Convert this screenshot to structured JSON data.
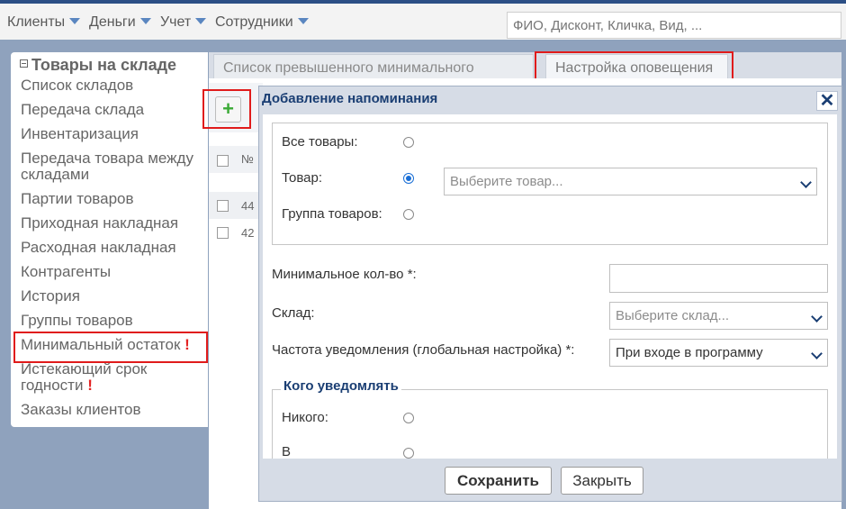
{
  "topbar": {
    "menus": [
      "Клиенты",
      "Деньги",
      "Учет",
      "Сотрудники"
    ],
    "search_placeholder": "ФИО, Дисконт, Кличка, Вид, ..."
  },
  "sidebar": {
    "title": "Товары на складе",
    "items": [
      {
        "label": "Список складов"
      },
      {
        "label": "Передача склада"
      },
      {
        "label": "Инвентаризация"
      },
      {
        "label": "Передача товара между складами"
      },
      {
        "label": "Партии товаров"
      },
      {
        "label": "Приходная накладная"
      },
      {
        "label": "Расходная накладная"
      },
      {
        "label": "Контрагенты"
      },
      {
        "label": "История"
      },
      {
        "label": "Группы товаров"
      },
      {
        "label": "Минимальный остаток",
        "badge": "!"
      },
      {
        "label": "Истекающий срок годности",
        "badge": "!"
      },
      {
        "label": "Заказы клиентов"
      }
    ]
  },
  "tabs": [
    {
      "label": "Список превышенного минимального остатка"
    },
    {
      "label": "Настройка оповещения"
    }
  ],
  "toolbar": {
    "add_label": "+"
  },
  "grid": {
    "header_num": "№",
    "rows": [
      {
        "num": "44"
      },
      {
        "num": "42"
      }
    ]
  },
  "dialog": {
    "title": "Добавление напоминания",
    "close_label": "✕",
    "product_scope": {
      "all_label": "Все товары:",
      "product_label": "Товар:",
      "product_placeholder": "Выберите товар...",
      "group_label": "Группа товаров:"
    },
    "min_qty_label": "Минимальное кол-во *:",
    "warehouse_label": "Склад:",
    "warehouse_placeholder": "Выберите склад...",
    "frequency_label": "Частота уведомления (глобальная настройка) *:",
    "frequency_value": "При входе в программу",
    "notify": {
      "legend": "Кого уведомлять",
      "nobody_label": "Никого:",
      "next_label": "В"
    },
    "save_label": "Сохранить",
    "close_button_label": "Закрыть"
  },
  "colors": {
    "accent": "#1a3e73",
    "highlight": "#e01b1b",
    "add_green": "#3aaa35",
    "radio_selected": "#1a6fd6"
  }
}
